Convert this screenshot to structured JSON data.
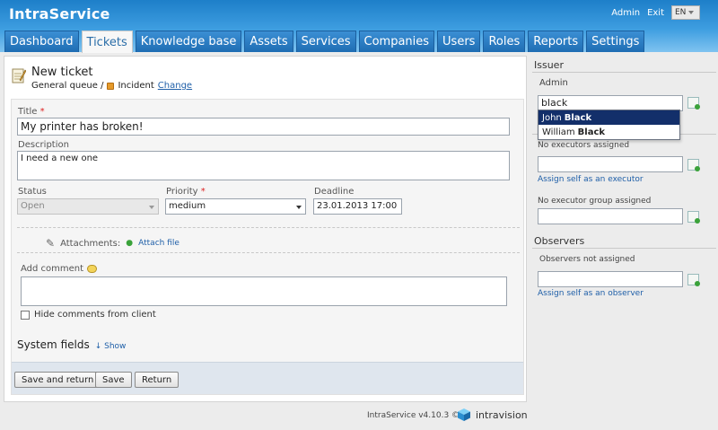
{
  "app": {
    "brand": "IntraService",
    "admin_link": "Admin",
    "exit_link": "Exit",
    "language": "EN"
  },
  "tabs": [
    {
      "label": "Dashboard"
    },
    {
      "label": "Tickets"
    },
    {
      "label": "Knowledge base"
    },
    {
      "label": "Assets"
    },
    {
      "label": "Services"
    },
    {
      "label": "Companies"
    },
    {
      "label": "Users"
    },
    {
      "label": "Roles"
    },
    {
      "label": "Reports"
    },
    {
      "label": "Settings"
    }
  ],
  "active_tab": "Tickets",
  "ticket": {
    "heading": "New ticket",
    "queue": "General queue /",
    "type": "Incident",
    "change_link": "Change"
  },
  "form": {
    "title_label": "Title",
    "title_value": "My printer has broken!",
    "description_label": "Description",
    "description_value": "I need a new one",
    "status_label": "Status",
    "status_value": "Open",
    "priority_label": "Priority",
    "priority_value": "medium",
    "deadline_label": "Deadline",
    "deadline_value": "23.01.2013 17:00",
    "required_mark": "*",
    "attachments_label": "Attachments:",
    "attach_file_link": "Attach file",
    "add_comment_label": "Add comment",
    "hide_comments_label": "Hide comments from client",
    "system_fields_label": "System fields",
    "show_link": "↓ Show"
  },
  "buttons": {
    "save_and_return": "Save and return",
    "save": "Save",
    "return": "Return"
  },
  "footer": {
    "version": "IntraService v4.10.3 ©",
    "vendor": "intravision"
  },
  "sidebar": {
    "issuer_heading": "Issuer",
    "issuer_name": "Admin",
    "issuer_search_value": "black",
    "executors_text": "No executors assigned",
    "assign_self_executor": "Assign self as an executor",
    "executor_group_text": "No executor group assigned",
    "observers_heading": "Observers",
    "observers_text": "Observers not assigned",
    "assign_self_observer": "Assign self as an observer"
  },
  "autocomplete": [
    {
      "first": "John",
      "last": "Black"
    },
    {
      "first": "William",
      "last": "Black"
    }
  ]
}
